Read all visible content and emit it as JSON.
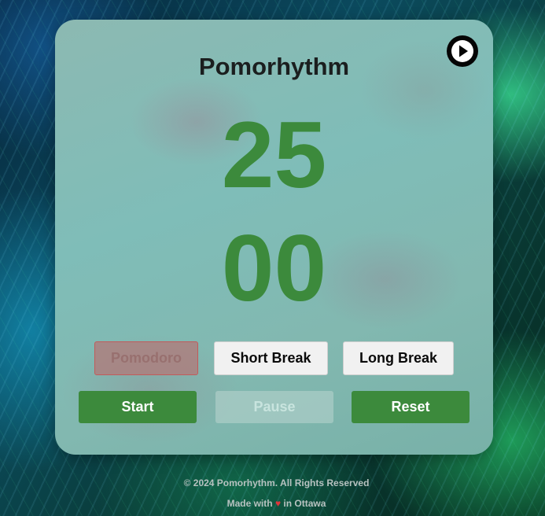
{
  "app": {
    "title": "Pomorhythm"
  },
  "timer": {
    "minutes": "25",
    "seconds": "00"
  },
  "modes": {
    "pomodoro_label": "Pomodoro",
    "short_break_label": "Short Break",
    "long_break_label": "Long Break",
    "active": "pomodoro"
  },
  "controls": {
    "start_label": "Start",
    "pause_label": "Pause",
    "reset_label": "Reset",
    "pause_disabled": true
  },
  "music": {
    "play_icon": "play-icon"
  },
  "footer": {
    "copyright": "© 2024 Pomorhythm. All Rights Reserved",
    "made_prefix": "Made with",
    "heart": "♥",
    "made_suffix": "in Ottawa"
  },
  "colors": {
    "accent_green": "#3c8a3c",
    "active_mode": "#b27878",
    "heart": "#e0353b"
  }
}
